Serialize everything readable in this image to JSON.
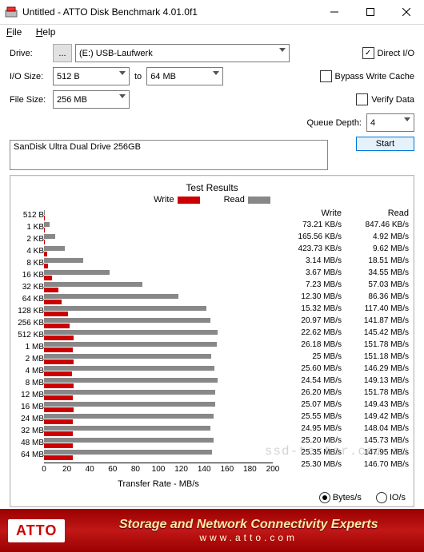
{
  "window": {
    "title": "Untitled - ATTO Disk Benchmark 4.01.0f1"
  },
  "menu": {
    "file": "File",
    "help": "Help"
  },
  "labels": {
    "drive": "Drive:",
    "iosize": "I/O Size:",
    "to": "to",
    "filesize": "File Size:",
    "queue": "Queue Depth:",
    "direct": "Direct I/O",
    "bypass": "Bypass Write Cache",
    "verify": "Verify Data",
    "start": "Start",
    "browse": "...",
    "results": "Test Results",
    "write": "Write",
    "read": "Read",
    "xlabel": "Transfer Rate - MB/s",
    "bytes": "Bytes/s",
    "ios": "IO/s"
  },
  "form": {
    "drive": "(E:) USB-Laufwerk",
    "ioFrom": "512 B",
    "ioTo": "64 MB",
    "fileSize": "256 MB",
    "queue": "4",
    "direct": true,
    "bypass": false,
    "verify": false,
    "unitBytes": true
  },
  "device": "SanDisk Ultra Dual Drive 256GB",
  "footer": {
    "logo": "ATTO",
    "line1": "Storage and Network Connectivity Experts",
    "line2": "www.atto.com"
  },
  "watermark": "ssd-tester.com.au",
  "xticks": [
    "0",
    "20",
    "40",
    "60",
    "80",
    "100",
    "120",
    "140",
    "160",
    "180",
    "200"
  ],
  "chart_data": {
    "type": "bar",
    "orientation": "horizontal",
    "xlabel": "Transfer Rate - MB/s",
    "xlim": [
      0,
      200
    ],
    "categories": [
      "512 B",
      "1 KB",
      "2 KB",
      "4 KB",
      "8 KB",
      "16 KB",
      "32 KB",
      "64 KB",
      "128 KB",
      "256 KB",
      "512 KB",
      "1 MB",
      "2 MB",
      "4 MB",
      "8 MB",
      "12 MB",
      "16 MB",
      "24 MB",
      "32 MB",
      "48 MB",
      "64 MB"
    ],
    "series": [
      {
        "name": "Write",
        "unit": "MB/s",
        "color": "#c00",
        "values": [
          0.0732,
          0.1656,
          0.4237,
          3.14,
          3.67,
          7.23,
          12.3,
          15.32,
          20.97,
          22.62,
          26.18,
          25,
          25.6,
          24.54,
          26.2,
          25.07,
          25.55,
          24.95,
          25.2,
          25.35,
          25.3
        ]
      },
      {
        "name": "Read",
        "unit": "MB/s",
        "color": "#888",
        "values": [
          0.8475,
          4.92,
          9.62,
          18.51,
          34.55,
          57.03,
          86.36,
          117.4,
          141.87,
          145.42,
          151.78,
          151.18,
          146.29,
          149.13,
          151.78,
          149.43,
          149.42,
          148.04,
          145.73,
          147.95,
          146.7
        ]
      }
    ],
    "display": [
      {
        "w": "73.21 KB/s",
        "r": "847.46 KB/s"
      },
      {
        "w": "165.56 KB/s",
        "r": "4.92 MB/s"
      },
      {
        "w": "423.73 KB/s",
        "r": "9.62 MB/s"
      },
      {
        "w": "3.14 MB/s",
        "r": "18.51 MB/s"
      },
      {
        "w": "3.67 MB/s",
        "r": "34.55 MB/s"
      },
      {
        "w": "7.23 MB/s",
        "r": "57.03 MB/s"
      },
      {
        "w": "12.30 MB/s",
        "r": "86.36 MB/s"
      },
      {
        "w": "15.32 MB/s",
        "r": "117.40 MB/s"
      },
      {
        "w": "20.97 MB/s",
        "r": "141.87 MB/s"
      },
      {
        "w": "22.62 MB/s",
        "r": "145.42 MB/s"
      },
      {
        "w": "26.18 MB/s",
        "r": "151.78 MB/s"
      },
      {
        "w": "25 MB/s",
        "r": "151.18 MB/s"
      },
      {
        "w": "25.60 MB/s",
        "r": "146.29 MB/s"
      },
      {
        "w": "24.54 MB/s",
        "r": "149.13 MB/s"
      },
      {
        "w": "26.20 MB/s",
        "r": "151.78 MB/s"
      },
      {
        "w": "25.07 MB/s",
        "r": "149.43 MB/s"
      },
      {
        "w": "25.55 MB/s",
        "r": "149.42 MB/s"
      },
      {
        "w": "24.95 MB/s",
        "r": "148.04 MB/s"
      },
      {
        "w": "25.20 MB/s",
        "r": "145.73 MB/s"
      },
      {
        "w": "25.35 MB/s",
        "r": "147.95 MB/s"
      },
      {
        "w": "25.30 MB/s",
        "r": "146.70 MB/s"
      }
    ]
  }
}
